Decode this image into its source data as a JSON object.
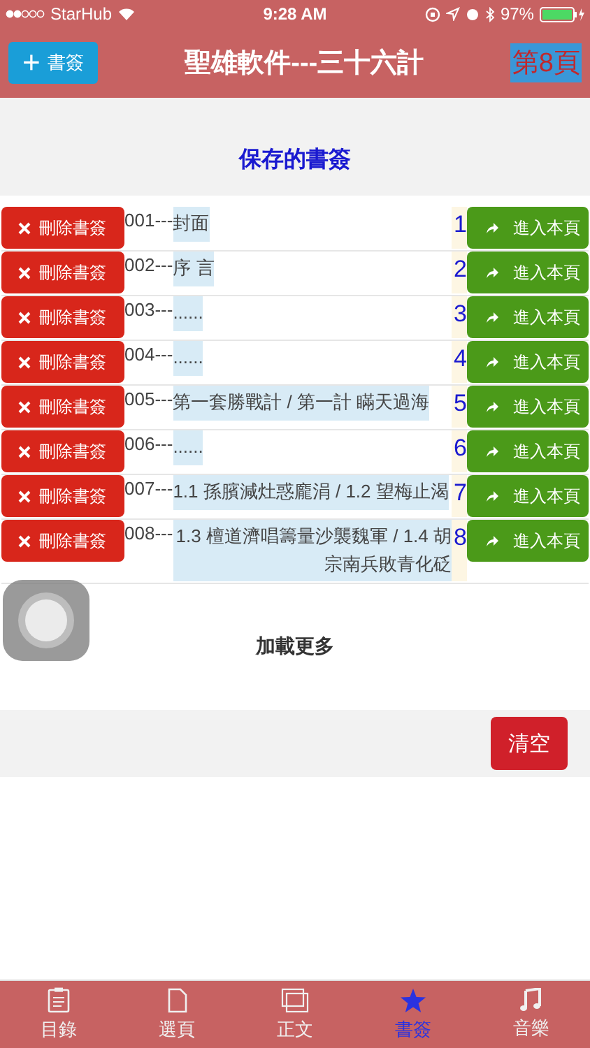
{
  "status_bar": {
    "carrier": "StarHub",
    "time": "9:28 AM",
    "battery": "97%"
  },
  "header": {
    "add_button": "書簽",
    "add_icon": "+",
    "title": "聖雄軟件---三十六計",
    "page_badge": "第8頁"
  },
  "section_title": "保存的書簽",
  "bookmarks": [
    {
      "delete": "刪除書簽",
      "prefix": "001---",
      "title": "封面",
      "page": "1",
      "open": "進入本頁"
    },
    {
      "delete": "刪除書簽",
      "prefix": "002---",
      "title": "序 言",
      "page": "2",
      "open": "進入本頁"
    },
    {
      "delete": "刪除書簽",
      "prefix": "003---",
      "title": "......",
      "page": "3",
      "open": "進入本頁"
    },
    {
      "delete": "刪除書簽",
      "prefix": "004---",
      "title": "......",
      "page": "4",
      "open": "進入本頁"
    },
    {
      "delete": "刪除書簽",
      "prefix": "005---",
      "title": "第一套勝戰計 / 第一計 瞞天過海",
      "page": "5",
      "open": "進入本頁"
    },
    {
      "delete": "刪除書簽",
      "prefix": "006---",
      "title": "......",
      "page": "6",
      "open": "進入本頁"
    },
    {
      "delete": "刪除書簽",
      "prefix": "007---",
      "title": "1.1 孫臏減灶惑龐涓 / 1.2 望梅止渴",
      "page": "7",
      "open": "進入本頁"
    },
    {
      "delete": "刪除書簽",
      "prefix": "008---",
      "title": "1.3 檀道濟唱籌量沙襲魏軍 / 1.4 胡宗南兵敗青化砭",
      "page": "8",
      "open": "進入本頁"
    }
  ],
  "load_more": "加載更多",
  "clear_button": "清空",
  "tabs": [
    {
      "kind": "clipboard",
      "label": "目錄",
      "selected": false
    },
    {
      "kind": "page",
      "label": "選頁",
      "selected": false
    },
    {
      "kind": "windows",
      "label": "正文",
      "selected": false
    },
    {
      "kind": "star",
      "label": "書簽",
      "selected": true
    },
    {
      "kind": "music",
      "label": "音樂",
      "selected": false
    }
  ]
}
